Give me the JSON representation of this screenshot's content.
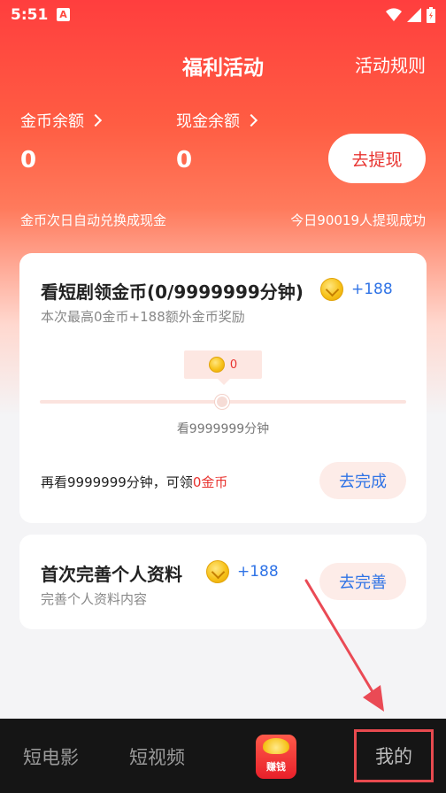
{
  "status_bar": {
    "time": "5:51",
    "notification_badge": "A"
  },
  "header": {
    "title": "福利活动",
    "rules_link": "活动规则"
  },
  "balances": {
    "coins": {
      "label": "金币余额",
      "value": "0"
    },
    "cash": {
      "label": "现金余额",
      "value": "0"
    },
    "withdraw_button": "去提现",
    "auto_convert_hint": "金币次日自动兑换成现金",
    "withdraw_success_hint": "今日90019人提现成功"
  },
  "task_watch": {
    "title": "看短剧领金币(0/9999999分钟)",
    "reward": "+188",
    "subtitle": "本次最高0金币+188额外金币奖励",
    "progress_coins": "0",
    "progress_fraction": 0,
    "progress_caption": "看9999999分钟",
    "remaining_prefix": "再看9999999分钟，可领",
    "remaining_amount": "0金币",
    "action_button": "去完成"
  },
  "task_profile": {
    "title": "首次完善个人资料",
    "reward": "+188",
    "subtitle": "完善个人资料内容",
    "action_button": "去完善"
  },
  "tabbar": {
    "tabs": [
      {
        "label": "短电影"
      },
      {
        "label": "短视频"
      },
      {
        "label": "赚钱"
      },
      {
        "label": "我的"
      }
    ]
  },
  "colors": {
    "accent_red": "#e8332f",
    "link_blue": "#2f73e6",
    "highlight_box": "#e84a4f"
  },
  "icons": [
    "wifi-icon",
    "signal-icon",
    "battery-icon",
    "coin-icon",
    "chevron-right-icon",
    "arrow-annotation-icon"
  ]
}
